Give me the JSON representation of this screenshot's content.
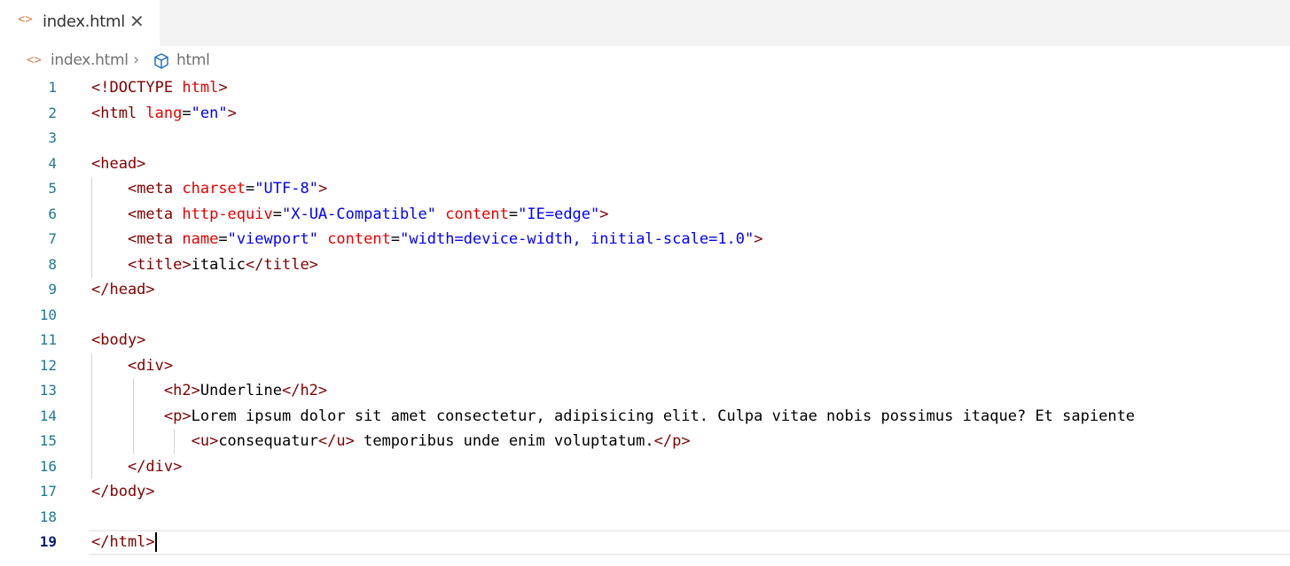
{
  "tab": {
    "icon": "<>",
    "label": "index.html",
    "close": "✕"
  },
  "breadcrumb": {
    "icon": "<>",
    "file": "index.html",
    "separator": "›",
    "symbol_icon": "cube-icon",
    "symbol": "html"
  },
  "colors": {
    "tag": "#800000",
    "attribute": "#e50000",
    "value": "#0000ff",
    "text": "#000000",
    "line_number": "#237893"
  },
  "editor": {
    "active_line": 19,
    "lines": [
      {
        "n": "1",
        "tokens": [
          [
            "t",
            "<!DOCTYPE "
          ],
          [
            "a",
            "html"
          ],
          [
            "t",
            ">"
          ]
        ]
      },
      {
        "n": "2",
        "tokens": [
          [
            "t",
            "<html "
          ],
          [
            "a",
            "lang"
          ],
          [
            "x",
            "="
          ],
          [
            "v",
            "\"en\""
          ],
          [
            "t",
            ">"
          ]
        ]
      },
      {
        "n": "3",
        "tokens": []
      },
      {
        "n": "4",
        "tokens": [
          [
            "t",
            "<head>"
          ]
        ]
      },
      {
        "n": "5",
        "tokens": [
          [
            "x",
            "    "
          ],
          [
            "t",
            "<meta "
          ],
          [
            "a",
            "charset"
          ],
          [
            "x",
            "="
          ],
          [
            "v",
            "\"UTF-8\""
          ],
          [
            "t",
            ">"
          ]
        ]
      },
      {
        "n": "6",
        "tokens": [
          [
            "x",
            "    "
          ],
          [
            "t",
            "<meta "
          ],
          [
            "a",
            "http-equiv"
          ],
          [
            "x",
            "="
          ],
          [
            "v",
            "\"X-UA-Compatible\""
          ],
          [
            "x",
            " "
          ],
          [
            "a",
            "content"
          ],
          [
            "x",
            "="
          ],
          [
            "v",
            "\"IE=edge\""
          ],
          [
            "t",
            ">"
          ]
        ]
      },
      {
        "n": "7",
        "tokens": [
          [
            "x",
            "    "
          ],
          [
            "t",
            "<meta "
          ],
          [
            "a",
            "name"
          ],
          [
            "x",
            "="
          ],
          [
            "v",
            "\"viewport\""
          ],
          [
            "x",
            " "
          ],
          [
            "a",
            "content"
          ],
          [
            "x",
            "="
          ],
          [
            "v",
            "\"width=device-width, initial-scale=1.0\""
          ],
          [
            "t",
            ">"
          ]
        ]
      },
      {
        "n": "8",
        "tokens": [
          [
            "x",
            "    "
          ],
          [
            "t",
            "<title>"
          ],
          [
            "x",
            "italic"
          ],
          [
            "t",
            "</title>"
          ]
        ]
      },
      {
        "n": "9",
        "tokens": [
          [
            "t",
            "</head>"
          ]
        ]
      },
      {
        "n": "10",
        "tokens": []
      },
      {
        "n": "11",
        "tokens": [
          [
            "t",
            "<body>"
          ]
        ]
      },
      {
        "n": "12",
        "tokens": [
          [
            "x",
            "    "
          ],
          [
            "t",
            "<div>"
          ]
        ]
      },
      {
        "n": "13",
        "tokens": [
          [
            "x",
            "        "
          ],
          [
            "t",
            "<h2>"
          ],
          [
            "x",
            "Underline"
          ],
          [
            "t",
            "</h2>"
          ]
        ]
      },
      {
        "n": "14",
        "tokens": [
          [
            "x",
            "        "
          ],
          [
            "t",
            "<p>"
          ],
          [
            "x",
            "Lorem ipsum dolor sit amet consectetur, adipisicing elit. Culpa vitae nobis possimus itaque? Et sapiente"
          ]
        ]
      },
      {
        "n": "15",
        "tokens": [
          [
            "x",
            "           "
          ],
          [
            "t",
            "<u>"
          ],
          [
            "x",
            "consequatur"
          ],
          [
            "t",
            "</u>"
          ],
          [
            "x",
            " temporibus unde enim voluptatum."
          ],
          [
            "t",
            "</p>"
          ]
        ]
      },
      {
        "n": "16",
        "tokens": [
          [
            "x",
            "    "
          ],
          [
            "t",
            "</div>"
          ]
        ]
      },
      {
        "n": "17",
        "tokens": [
          [
            "t",
            "</body>"
          ]
        ]
      },
      {
        "n": "18",
        "tokens": []
      },
      {
        "n": "19",
        "tokens": [
          [
            "t",
            "</html>"
          ]
        ]
      }
    ]
  }
}
